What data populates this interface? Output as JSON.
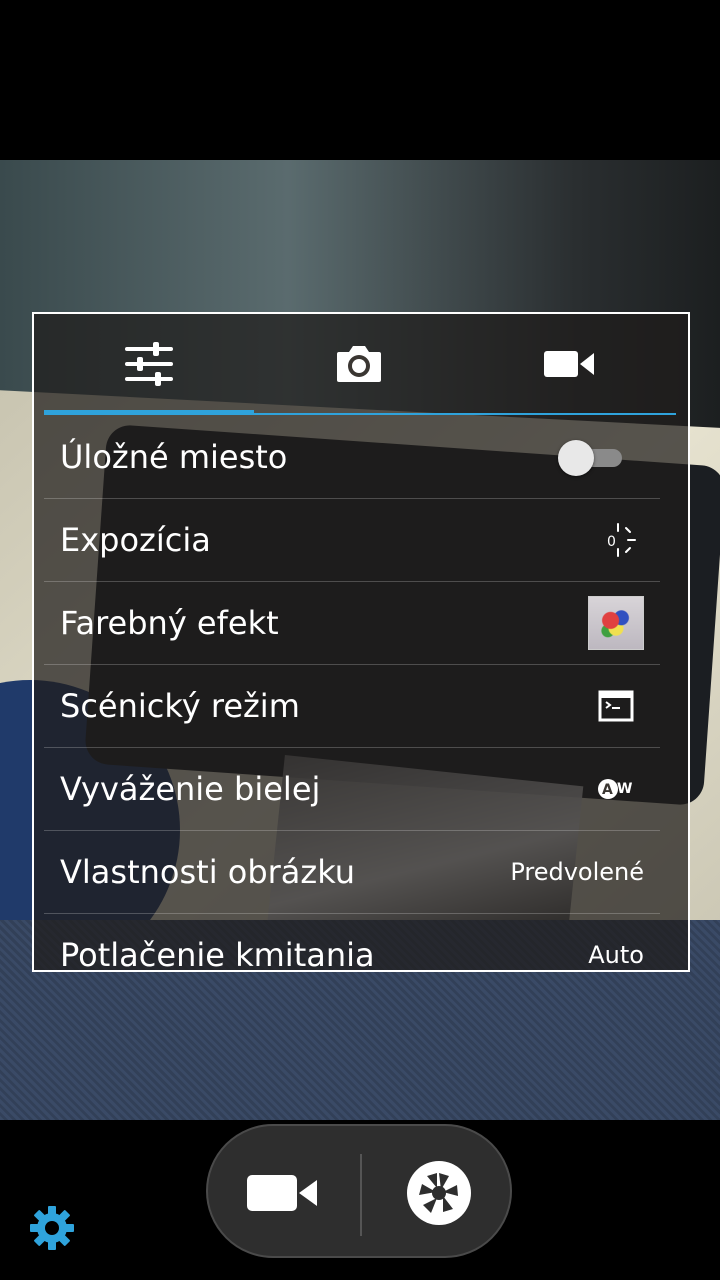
{
  "tabs": [
    {
      "name": "general",
      "icon": "sliders-icon"
    },
    {
      "name": "photo",
      "icon": "camera-icon"
    },
    {
      "name": "video",
      "icon": "video-icon"
    }
  ],
  "settings": [
    {
      "label": "Úložné miesto",
      "control": "toggle",
      "state": "off"
    },
    {
      "label": "Expozícia",
      "control": "icon",
      "icon": "exposure-icon",
      "icon_text": "0"
    },
    {
      "label": "Farebný efekt",
      "control": "icon",
      "icon": "color-effect-thumbnail"
    },
    {
      "label": "Scénický režim",
      "control": "icon",
      "icon": "scene-mode-icon"
    },
    {
      "label": "Vyváženie bielej",
      "control": "icon",
      "icon": "white-balance-auto-icon",
      "icon_text": "AW"
    },
    {
      "label": "Vlastnosti obrázku",
      "control": "value",
      "value": "Predvolené"
    },
    {
      "label": "Potlačenie kmitania",
      "control": "value",
      "value": "Auto"
    }
  ],
  "bottom_bar": {
    "video_icon": "video-record-icon",
    "shutter_icon": "shutter-icon",
    "settings_icon": "gear-icon"
  },
  "colors": {
    "accent": "#2fa3dc",
    "panel_border": "#ffffff",
    "settings_icon": "#2fa3dc"
  }
}
